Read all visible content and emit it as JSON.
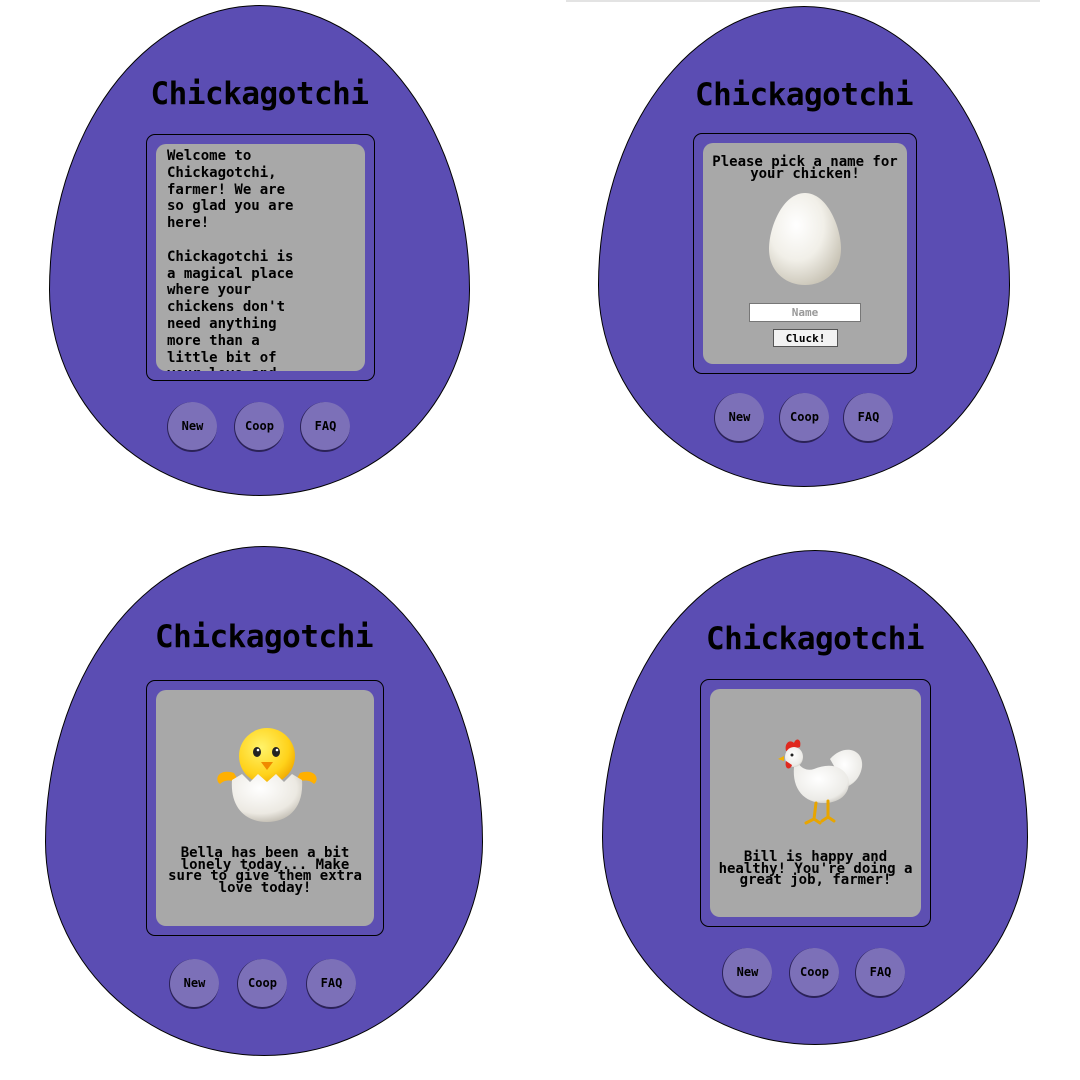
{
  "app": {
    "title": "Chickagotchi"
  },
  "nav": {
    "new_label": "New",
    "coop_label": "Coop",
    "faq_label": "FAQ"
  },
  "screens": {
    "welcome": {
      "text": "Welcome to\nChickagotchi,\nfarmer! We are\nso glad you are\nhere!\n\nChickagotchi is\na magical place\nwhere your\nchickens don't\nneed anything\nmore than a\nlittle bit of\nyour love and"
    },
    "naming": {
      "prompt": "Please pick a name for your chicken!",
      "name_placeholder": "Name",
      "submit_label": "Cluck!",
      "icon": "egg-icon"
    },
    "lonely": {
      "message": "Bella has been a bit lonely today... Make sure to give them extra love today!",
      "icon": "hatching-chick-icon"
    },
    "happy": {
      "message": "Bill is happy and healthy! You're doing a great job, farmer!",
      "icon": "rooster-icon"
    }
  },
  "colors": {
    "device": "#5b4db3",
    "screen": "#a8a8a8",
    "button": "#7c70b8"
  }
}
